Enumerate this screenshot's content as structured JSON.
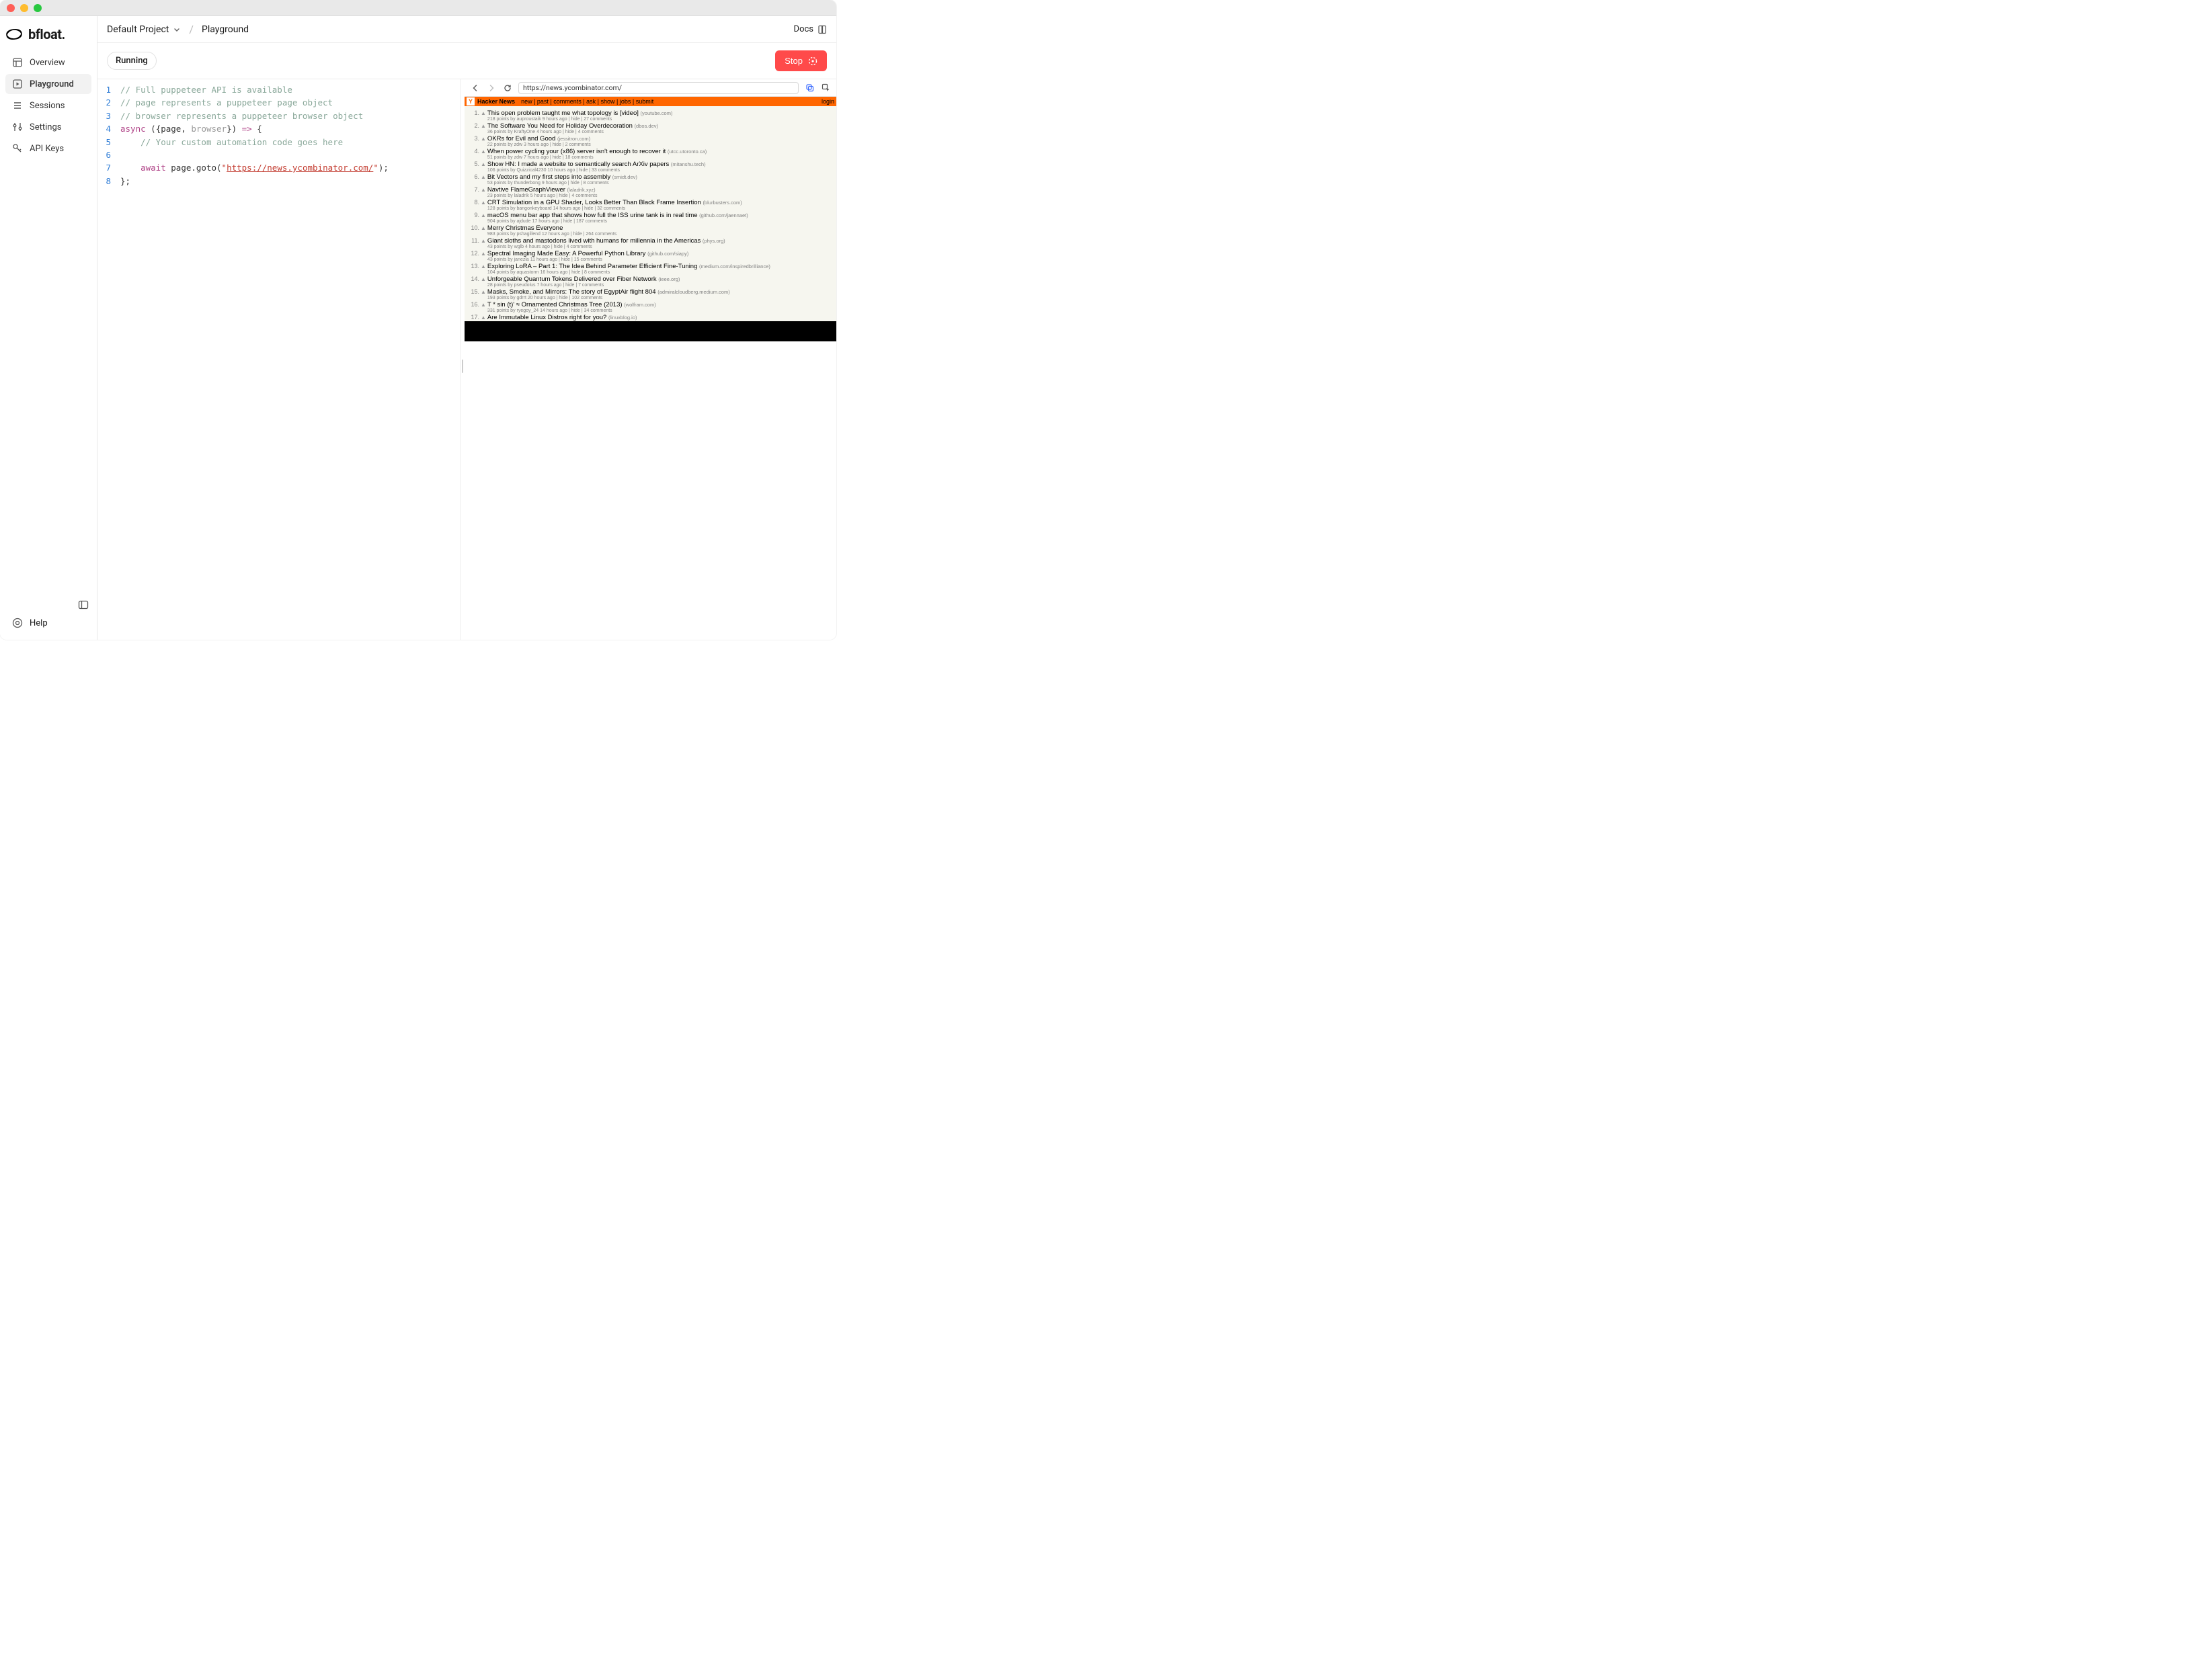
{
  "app_name": "bfloat.",
  "sidebar": {
    "items": [
      {
        "label": "Overview",
        "icon": "grid"
      },
      {
        "label": "Playground",
        "icon": "play",
        "active": true
      },
      {
        "label": "Sessions",
        "icon": "list"
      },
      {
        "label": "Settings",
        "icon": "sliders"
      },
      {
        "label": "API Keys",
        "icon": "key"
      }
    ],
    "help_label": "Help"
  },
  "topbar": {
    "project_name": "Default Project",
    "breadcrumb": "Playground",
    "docs_label": "Docs"
  },
  "actionbar": {
    "status": "Running",
    "stop_label": "Stop"
  },
  "editor": {
    "lines": [
      {
        "n": "1",
        "tokens": [
          {
            "t": "// Full puppeteer API is available",
            "c": "c-comment"
          }
        ]
      },
      {
        "n": "2",
        "tokens": [
          {
            "t": "// page represents a puppeteer page object",
            "c": "c-comment"
          }
        ]
      },
      {
        "n": "3",
        "tokens": [
          {
            "t": "// browser represents a puppeteer browser object",
            "c": "c-comment"
          }
        ]
      },
      {
        "n": "4",
        "tokens": [
          {
            "t": "async",
            "c": "c-kw"
          },
          {
            "t": " ({",
            "c": "c-punc"
          },
          {
            "t": "page",
            "c": "c-param"
          },
          {
            "t": ", ",
            "c": "c-punc"
          },
          {
            "t": "browser",
            "c": "c-dim"
          },
          {
            "t": "}) ",
            "c": "c-punc"
          },
          {
            "t": "=>",
            "c": "c-kw"
          },
          {
            "t": " {",
            "c": "c-punc"
          }
        ]
      },
      {
        "n": "5",
        "tokens": [
          {
            "t": "    ",
            "c": ""
          },
          {
            "t": "// Your custom automation code goes here",
            "c": "c-comment"
          }
        ]
      },
      {
        "n": "6",
        "tokens": [
          {
            "t": " ",
            "c": ""
          }
        ]
      },
      {
        "n": "7",
        "tokens": [
          {
            "t": "    ",
            "c": ""
          },
          {
            "t": "await",
            "c": "c-kw"
          },
          {
            "t": " page.goto(",
            "c": "c-punc"
          },
          {
            "t": "\"",
            "c": "c-str"
          },
          {
            "t": "https://news.ycombinator.com/",
            "c": "c-url"
          },
          {
            "t": "\"",
            "c": "c-str"
          },
          {
            "t": ");",
            "c": "c-punc"
          }
        ]
      },
      {
        "n": "8",
        "tokens": [
          {
            "t": "};",
            "c": "c-punc"
          }
        ]
      }
    ]
  },
  "browser": {
    "url": "https://news.ycombinator.com/"
  },
  "hn": {
    "brand": "Hacker News",
    "nav": [
      "new",
      "past",
      "comments",
      "ask",
      "show",
      "jobs",
      "submit"
    ],
    "login": "login",
    "stories": [
      {
        "rank": "1.",
        "title": "This open problem taught me what topology is [video]",
        "domain": "(youtube.com)",
        "sub": "218 points by auproustaik 9 hours ago | hide | 27 comments"
      },
      {
        "rank": "2.",
        "title": "The Software You Need for Holiday Overdecoration",
        "domain": "(dbos.dev)",
        "sub": "36 points by KraftyOne 4 hours ago | hide | 4 comments"
      },
      {
        "rank": "3.",
        "title": "OKRs for Evil and Good",
        "domain": "(jessitron.com)",
        "sub": "22 points by zdw 3 hours ago | hide | 2 comments"
      },
      {
        "rank": "4.",
        "title": "When power cycling your (x86) server isn't enough to recover it",
        "domain": "(utcc.utoronto.ca)",
        "sub": "51 points by zdw 7 hours ago | hide | 18 comments"
      },
      {
        "rank": "5.",
        "title": "Show HN: I made a website to semantically search ArXiv papers",
        "domain": "(mitanshu.tech)",
        "sub": "106 points by Quizzical4230 10 hours ago | hide | 33 comments"
      },
      {
        "rank": "6.",
        "title": "Bit Vectors and my first steps into assembly",
        "domain": "(smidt.dev)",
        "sub": "53 points by thunderbong 9 hours ago | hide | 8 comments"
      },
      {
        "rank": "7.",
        "title": "Navtive FlameGraphViewer",
        "domain": "(laladrik.xyz)",
        "sub": "23 points by laladrik 5 hours ago | hide | 4 comments"
      },
      {
        "rank": "8.",
        "title": "CRT Simulation in a GPU Shader, Looks Better Than Black Frame Insertion",
        "domain": "(blurbusters.com)",
        "sub": "128 points by bangonkeyboard 14 hours ago | hide | 32 comments"
      },
      {
        "rank": "9.",
        "title": "macOS menu bar app that shows how full the ISS urine tank is in real time",
        "domain": "(github.com/jaennaet)",
        "sub": "904 points by ajdude 17 hours ago | hide | 187 comments"
      },
      {
        "rank": "10.",
        "title": "Merry Christmas Everyone",
        "domain": "",
        "sub": "983 points by pshagillend 12 hours ago | hide | 264 comments"
      },
      {
        "rank": "11.",
        "title": "Giant sloths and mastodons lived with humans for millennia in the Americas",
        "domain": "(phys.org)",
        "sub": "43 points by wglb 4 hours ago | hide | 4 comments"
      },
      {
        "rank": "12.",
        "title": "Spectral Imaging Made Easy: A Powerful Python Library",
        "domain": "(github.com/siapy)",
        "sub": "43 points by janezla 11 hours ago | hide | 15 comments"
      },
      {
        "rank": "13.",
        "title": "Exploring LoRA – Part 1: The Idea Behind Parameter Efficient Fine-Tuning",
        "domain": "(medium.com/inspiredbrilliance)",
        "sub": "104 points by aquastorm 16 hours ago | hide | 8 comments"
      },
      {
        "rank": "14.",
        "title": "Unforgeable Quantum Tokens Delivered over Fiber Network",
        "domain": "(ieee.org)",
        "sub": "28 points by pseudolus 7 hours ago | hide | 7 comments"
      },
      {
        "rank": "15.",
        "title": "Masks, Smoke, and Mirrors: The story of EgyptAir flight 804",
        "domain": "(admiralcloudberg.medium.com)",
        "sub": "193 points by gdrrt 20 hours ago | hide | 102 comments"
      },
      {
        "rank": "16.",
        "title": "T * sin (t)' ≈ Ornamented Christmas Tree (2013)",
        "domain": "(wolfram.com)",
        "sub": "331 points by ryegoy_24 14 hours ago | hide | 34 comments"
      },
      {
        "rank": "17.",
        "title": "Are Immutable Linux Distros right for you?",
        "domain": "(linuxblog.io)",
        "sub": ""
      }
    ]
  }
}
